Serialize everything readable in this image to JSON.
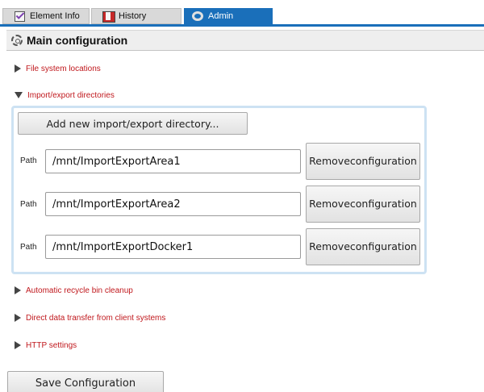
{
  "tabs": [
    {
      "label": "Element Info",
      "icon": "element-info-icon",
      "active": false
    },
    {
      "label": "History",
      "icon": "history-icon",
      "active": false
    },
    {
      "label": "Admin",
      "icon": "admin-icon",
      "active": true
    }
  ],
  "header": {
    "title": "Main configuration",
    "icon": "gear-icon"
  },
  "sections": {
    "file_system": {
      "label": "File system locations",
      "expanded": false
    },
    "import_export": {
      "label": "Import/export directories",
      "expanded": true
    },
    "recycle": {
      "label": "Automatic recycle bin cleanup",
      "expanded": false
    },
    "direct_transfer": {
      "label": "Direct data transfer from client systems",
      "expanded": false
    },
    "http": {
      "label": "HTTP settings",
      "expanded": false
    }
  },
  "import_export": {
    "add_button": "Add new import/export directory...",
    "path_label": "Path",
    "remove_line1": "Remove",
    "remove_line2": "configuration",
    "directories": [
      "/mnt/ImportExportArea1",
      "/mnt/ImportExportArea2",
      "/mnt/ImportExportDocker1"
    ]
  },
  "save_button": "Save Configuration",
  "colors": {
    "accent": "#1a6fba",
    "section_link": "#c0181d",
    "panel_border": "#cde2f3"
  }
}
